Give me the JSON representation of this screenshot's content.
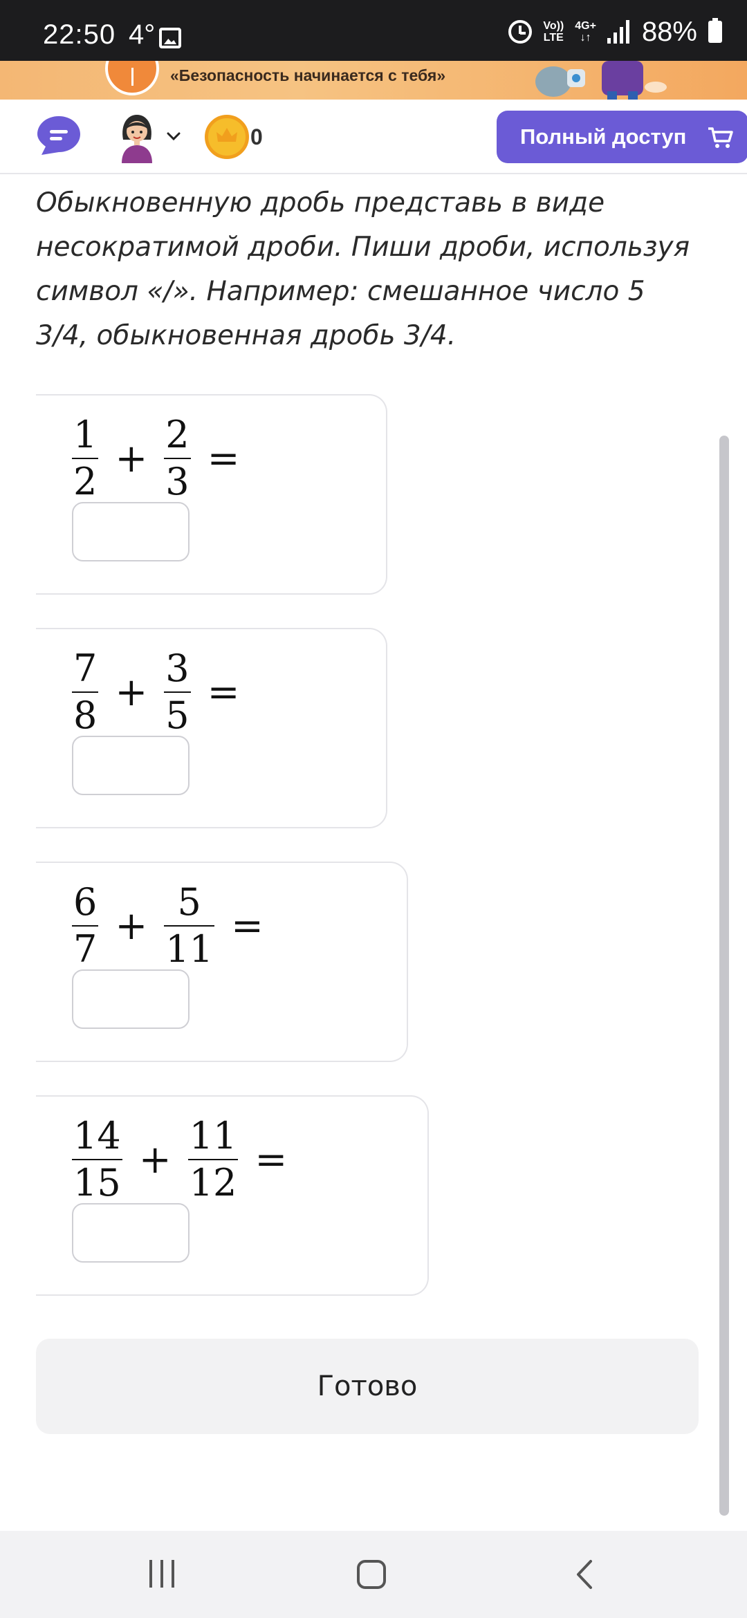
{
  "status_bar": {
    "time": "22:50",
    "temperature": "4°",
    "net_top": "Vo))",
    "net_bottom": "LTE",
    "net2_top": "4G+",
    "net2_bottom": "↓↑",
    "battery": "88%"
  },
  "banner": {
    "text": "«Безопасность начинается с тебя»"
  },
  "header": {
    "coins": "0",
    "full_access_label": "Полный доступ",
    "colors": {
      "accent": "#6b5bd6",
      "coin": "#f6bd2b"
    }
  },
  "task": {
    "instructions": "Обыкновенную дробь представь в виде несократимой дроби. Пиши дроби, используя символ «/». Например: смешанное число 5 3/4, обыкновенная дробь 3/4.",
    "problems": [
      {
        "a_num": "1",
        "a_den": "2",
        "op": "+",
        "b_num": "2",
        "b_den": "3",
        "eq": "=",
        "answer": ""
      },
      {
        "a_num": "7",
        "a_den": "8",
        "op": "+",
        "b_num": "3",
        "b_den": "5",
        "eq": "=",
        "answer": ""
      },
      {
        "a_num": "6",
        "a_den": "7",
        "op": "+",
        "b_num": "5",
        "b_den": "11",
        "eq": "=",
        "answer": ""
      },
      {
        "a_num": "14",
        "a_den": "15",
        "op": "+",
        "b_num": "11",
        "b_den": "12",
        "eq": "=",
        "answer": ""
      }
    ],
    "done_label": "Готово"
  },
  "icons": {
    "chat": "chat-bubble-icon",
    "avatar": "user-avatar",
    "chevron": "chevron-down-icon",
    "coin": "crown-coin-icon",
    "cart": "cart-icon",
    "nav_recent": "recent-apps-icon",
    "nav_home": "home-icon",
    "nav_back": "back-icon"
  }
}
